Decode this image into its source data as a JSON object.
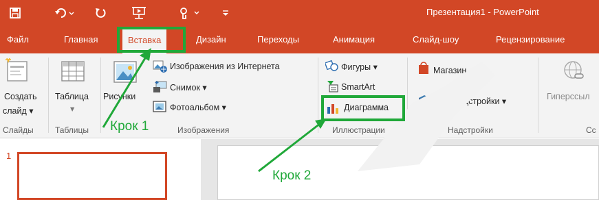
{
  "window": {
    "title": "Презентация1 - PowerPoint"
  },
  "quick_access": {
    "save_icon": "save-icon",
    "undo_icon": "undo-icon",
    "redo_icon": "redo-icon",
    "slideshow_icon": "slideshow-icon",
    "touch_icon": "touch-mode-icon",
    "customize_icon": "customize-qat-icon"
  },
  "tabs": [
    {
      "label": "Файл"
    },
    {
      "label": "Главная"
    },
    {
      "label": "Вставка",
      "active": true
    },
    {
      "label": "Дизайн"
    },
    {
      "label": "Переходы"
    },
    {
      "label": "Анимация"
    },
    {
      "label": "Слайд-шоу"
    },
    {
      "label": "Рецензирование"
    }
  ],
  "ribbon": {
    "slides_group": {
      "new_slide_line1": "Создать",
      "new_slide_line2": "слайд ▾",
      "label": "Слайды"
    },
    "tables_group": {
      "table_label": "Таблица",
      "table_dropdown": "▾",
      "label": "Таблицы"
    },
    "images_group": {
      "pictures_label": "Рисунки",
      "online_pictures_label": "Изображения из Интернета",
      "screenshot_label": "Снимок ▾",
      "photo_album_label": "Фотоальбом ▾",
      "label": "Изображения"
    },
    "illustrations_group": {
      "shapes_label": "Фигуры ▾",
      "smartart_label": "SmartArt",
      "chart_label": "Диаграмма",
      "label": "Иллюстрации"
    },
    "addins_group": {
      "store_label": "Магазин",
      "my_addins_label": "Мои надстройки ▾",
      "label": "Надстройки"
    },
    "links_group": {
      "hyperlink_label": "Гиперссыл",
      "label": "Сс"
    }
  },
  "slides_pane": {
    "slide_number": "1"
  },
  "annotations": {
    "step1": "Крок 1",
    "step2": "Крок 2",
    "color": "#20a839"
  },
  "colors": {
    "accent": "#d24726",
    "ribbon_bg": "#f3f3f3",
    "highlight": "#20a839"
  }
}
